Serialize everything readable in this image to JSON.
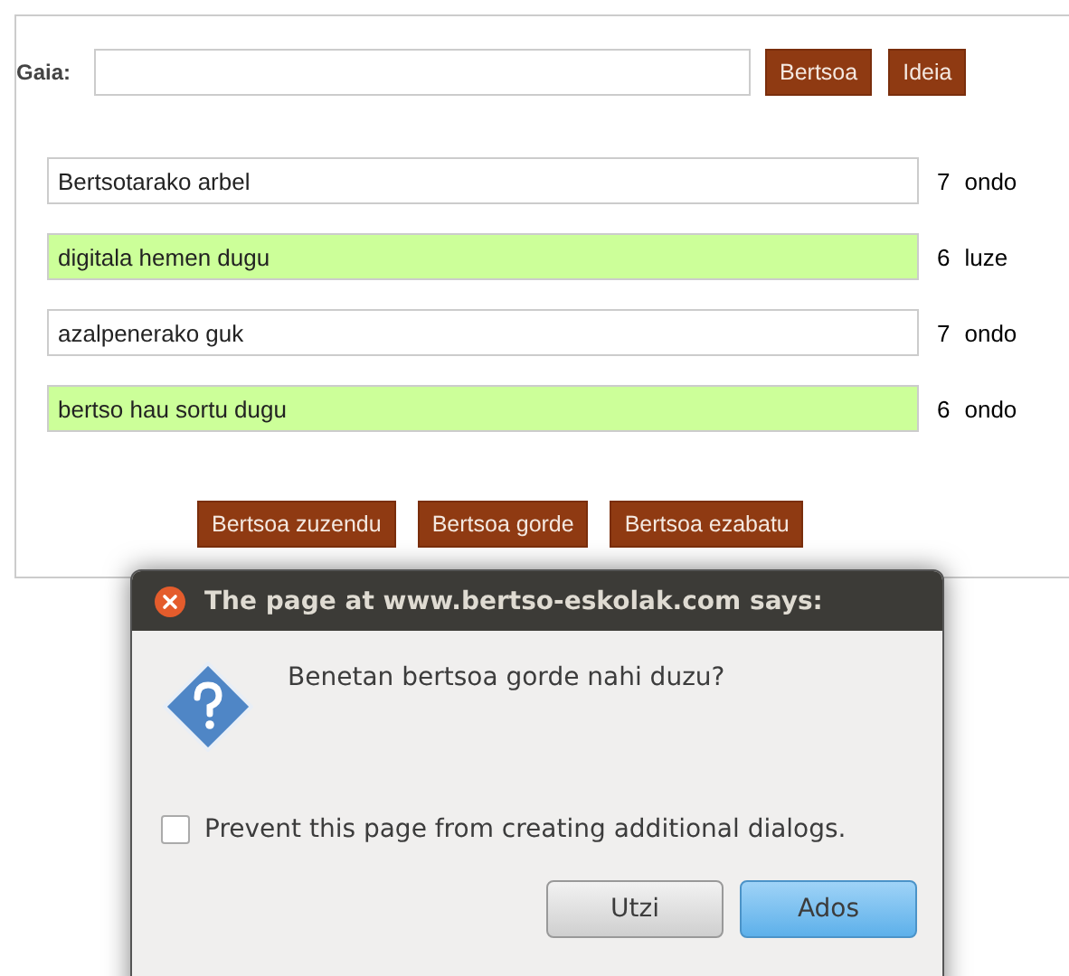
{
  "topic": {
    "label": "Gaia:"
  },
  "top_buttons": [
    "Bertsoa",
    "Ideia"
  ],
  "lines": [
    {
      "text": "Bertsotarako arbel",
      "highlighted": false,
      "count": "7",
      "status": "ondo"
    },
    {
      "text": "digitala hemen dugu",
      "highlighted": true,
      "count": "6",
      "status": "luze"
    },
    {
      "text": "azalpenerako guk",
      "highlighted": false,
      "count": "7",
      "status": "ondo"
    },
    {
      "text": "bertso hau sortu dugu",
      "highlighted": true,
      "count": "6",
      "status": "ondo"
    }
  ],
  "bottom_buttons": [
    "Bertsoa zuzendu",
    "Bertsoa gorde",
    "Bertsoa ezabatu"
  ],
  "dialog": {
    "title": "The page at www.bertso-eskolak.com says:",
    "message": "Benetan bertsoa gorde nahi duzu?",
    "checkbox": {
      "label": "Prevent this page from creating additional dialogs.",
      "checked": false
    },
    "buttons": [
      {
        "label": "Utzi",
        "default": false
      },
      {
        "label": "Ados",
        "default": true
      }
    ]
  }
}
